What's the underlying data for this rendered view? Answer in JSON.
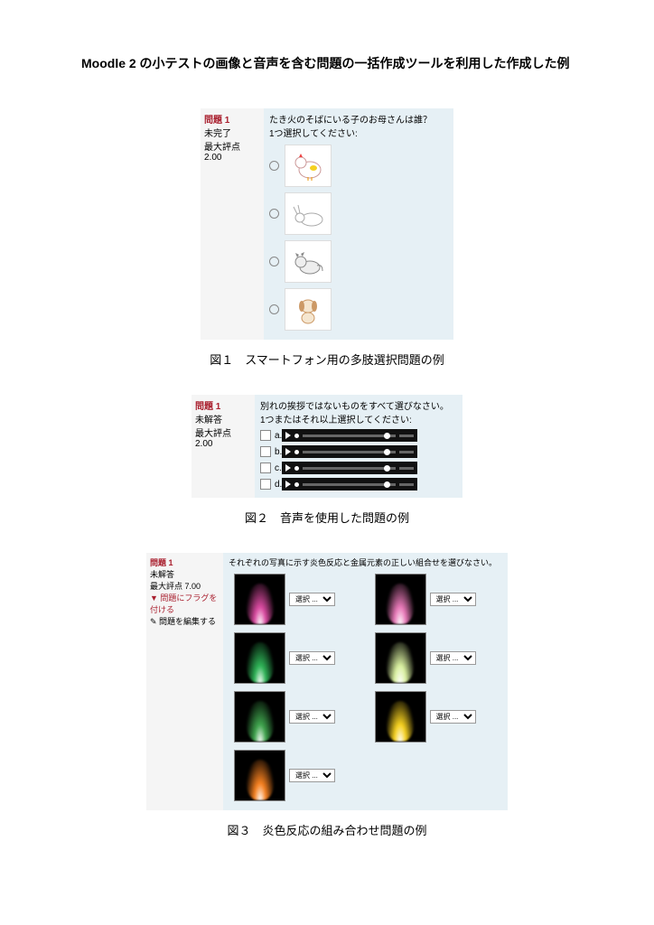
{
  "title": "Moodle 2 の小テストの画像と音声を含む問題の一括作成ツールを利用した作成した例",
  "fig1": {
    "qnum": "問題 1",
    "status": "未完了",
    "max": "最大評点 2.00",
    "qtext": "たき火のそばにいる子のお母さんは誰？",
    "instr": "1つ選択してください:",
    "caption": "図１　スマートフォン用の多肢選択問題の例"
  },
  "fig2": {
    "qnum": "問題 1",
    "status": "未解答",
    "max": "最大評点 2.00",
    "qtext": "別れの挨拶ではないものをすべて選びなさい。",
    "instr": "1つまたはそれ以上選択してください:",
    "opts": [
      "a.",
      "b.",
      "c.",
      "d."
    ],
    "caption": "図２　音声を使用した問題の例"
  },
  "fig3": {
    "qnum": "問題 1",
    "status": "未解答",
    "max": "最大評点 7.00",
    "flag": "▼ 問題にフラグを付ける",
    "edit": "✎ 問題を編集する",
    "qtext": "それぞれの写真に示す炎色反応と金属元素の正しい組合せを選びなさい。",
    "sel": "選択 ...",
    "flames": [
      "#d94aa0",
      "#e879b8",
      "#2fb357",
      "#d9f0a0",
      "#3fa34d",
      "#f5d020",
      "#f58020"
    ],
    "caption": "図３　炎色反応の組み合わせ問題の例"
  }
}
